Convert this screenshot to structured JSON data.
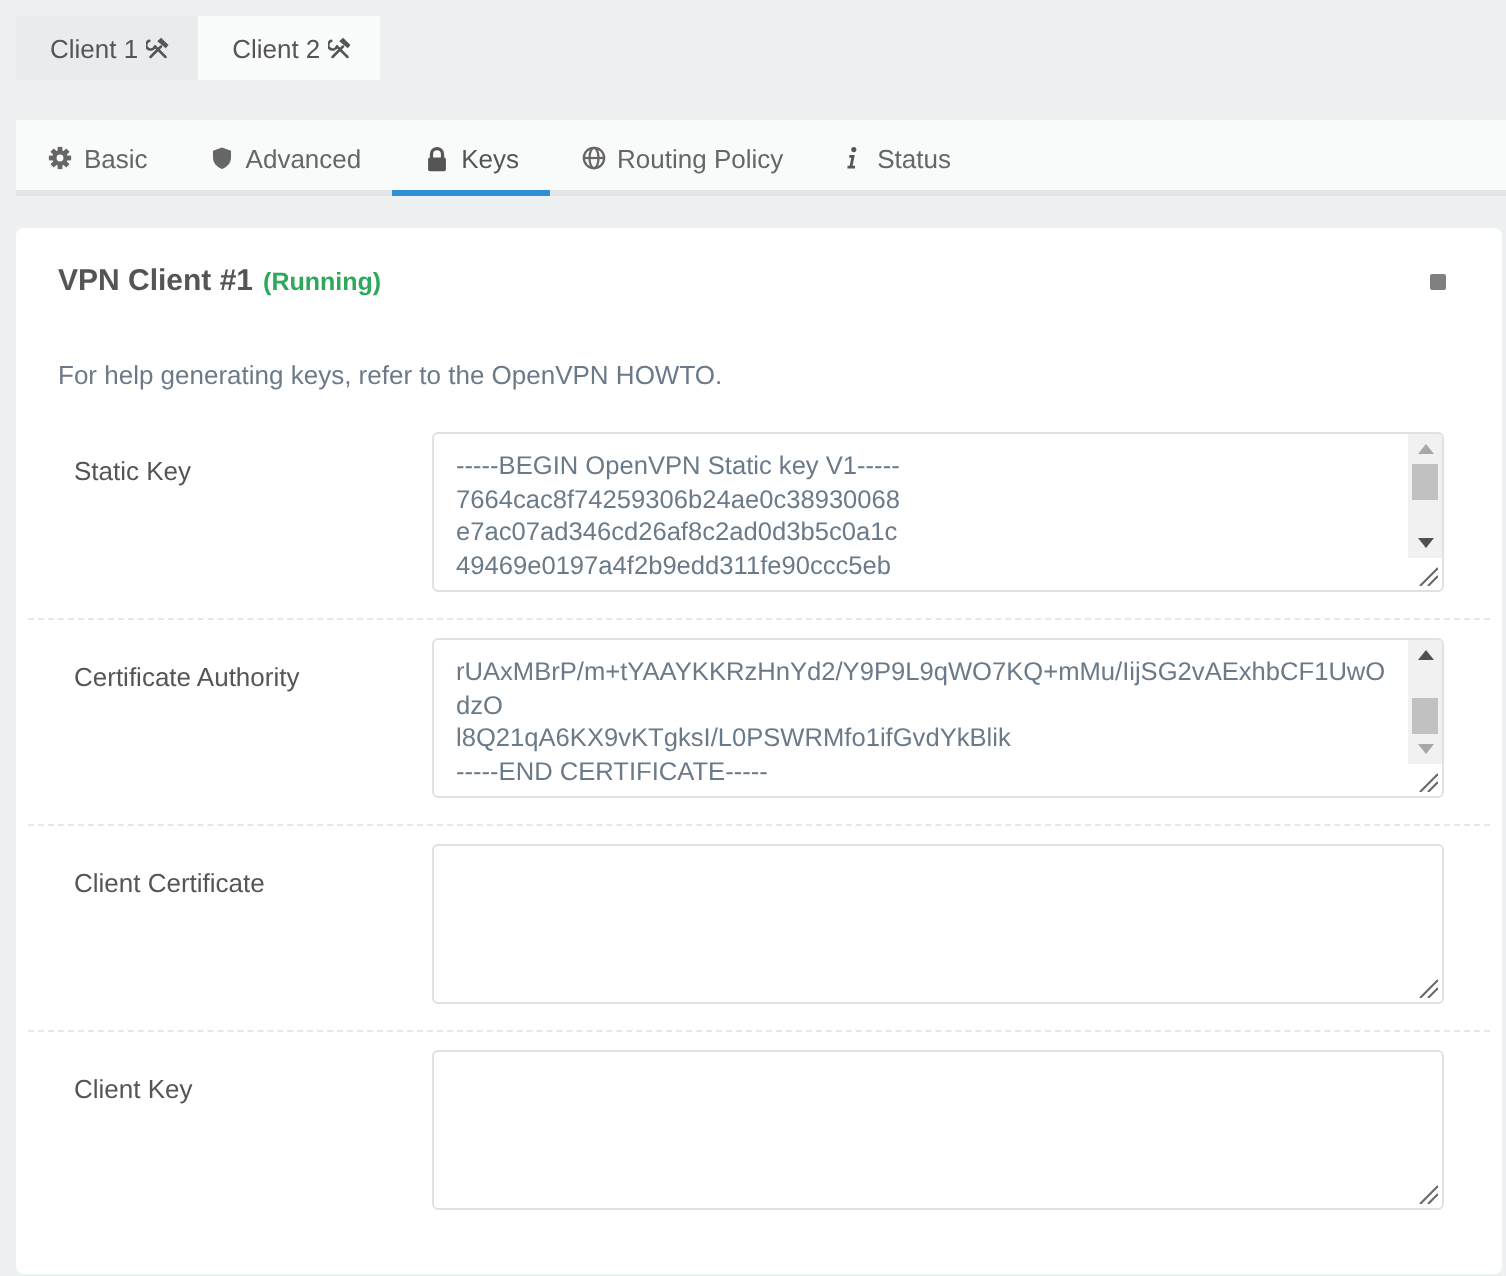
{
  "client_tabs": [
    {
      "label": "Client 1",
      "selected": true
    },
    {
      "label": "Client 2",
      "selected": false
    }
  ],
  "section_tabs": [
    {
      "label": "Basic",
      "selected": false
    },
    {
      "label": "Advanced",
      "selected": false
    },
    {
      "label": "Keys",
      "selected": true
    },
    {
      "label": "Routing Policy",
      "selected": false
    },
    {
      "label": "Status",
      "selected": false
    }
  ],
  "card": {
    "title": "VPN Client #1",
    "status": "(Running)",
    "help": "For help generating keys, refer to the OpenVPN HOWTO.",
    "fields": [
      {
        "label": "Static Key",
        "value": "-----BEGIN OpenVPN Static key V1-----\n7664cac8f74259306b24ae0c38930068\ne7ac07ad346cd26af8c2ad0d3b5c0a1c\n49469e0197a4f2b9edd311fe90ccc5eb"
      },
      {
        "label": "Certificate Authority",
        "value": "rUAxMBrP/m+tYAAYKKRzHnYd2/Y9P9L9qWO7KQ+mMu/IijSG2vAExhbCF1UwO\ndzO\nl8Q21qA6KX9vKTgksI/L0PSWRMfo1ifGvdYkBlik\n-----END CERTIFICATE-----"
      },
      {
        "label": "Client Certificate"
      },
      {
        "label": "Client Key"
      }
    ]
  }
}
